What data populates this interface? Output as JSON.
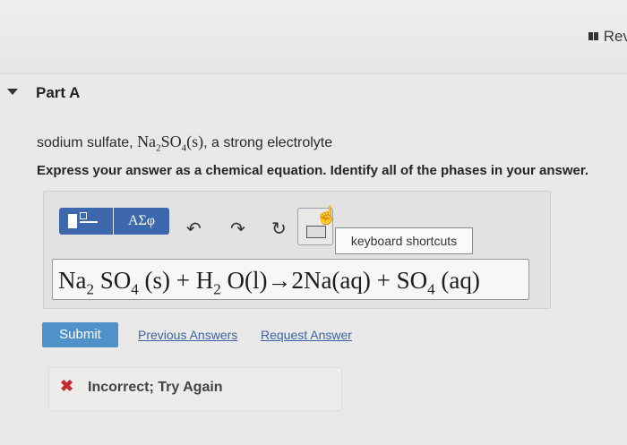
{
  "header": {
    "review_label": "Rev"
  },
  "part": {
    "title": "Part A"
  },
  "question": {
    "prefix": "sodium sulfate, ",
    "formula_na": "Na",
    "formula_na_sub": "2",
    "formula_so": "SO",
    "formula_so_sub": "4",
    "formula_phase": "(s)",
    "suffix": ", a strong electrolyte"
  },
  "instruction": "Express your answer as a chemical equation. Identify all of the phases in your answer.",
  "toolbar": {
    "symbols_label": "ΑΣφ",
    "undo_glyph": "↶",
    "redo_glyph": "↷",
    "reset_glyph": "↻",
    "tooltip": "keyboard shortcuts"
  },
  "answer": {
    "p1": "Na",
    "s1": "2",
    "p2": " SO",
    "s2": "4",
    "p3": " (s) + H",
    "s3": "2",
    "p4": " O(l)→2Na(aq) + SO",
    "s4": "4",
    "p5": " (aq)"
  },
  "actions": {
    "submit": "Submit",
    "previous_answers": "Previous Answers",
    "request_answer": "Request Answer"
  },
  "feedback": {
    "icon": "✖",
    "text": "Incorrect; Try Again"
  }
}
